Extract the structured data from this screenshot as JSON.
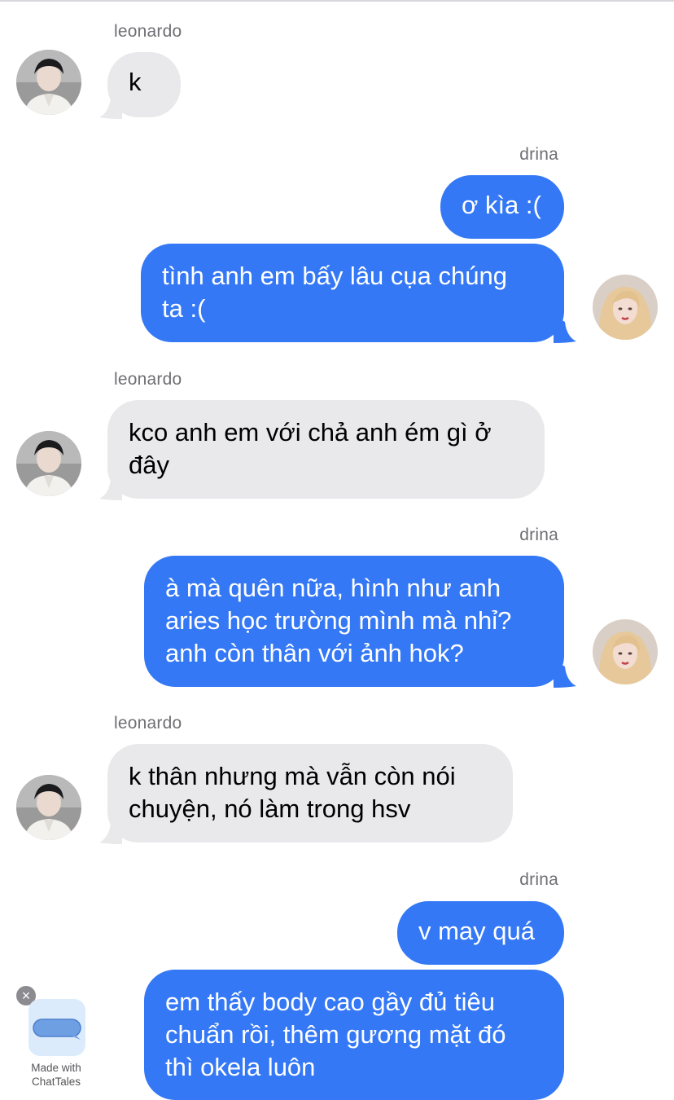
{
  "messages": [
    {
      "sender": "leonardo",
      "text": "k"
    },
    {
      "sender": "drina",
      "text": "ơ kìa :("
    },
    {
      "sender": "drina",
      "text": "tình anh em bấy lâu cụa chúng\nta :("
    },
    {
      "sender": "leonardo",
      "text": "kco anh em với chả anh ém gì ở\nđây"
    },
    {
      "sender": "drina",
      "text": "à mà quên nữa, hình như anh\naries học trường mình mà nhỉ?\nanh còn thân với ảnh hok?"
    },
    {
      "sender": "leonardo",
      "text": "k thân nhưng mà vẫn còn nói\nchuyện, nó làm trong hsv"
    },
    {
      "sender": "drina",
      "text": "v may quá"
    },
    {
      "sender": "drina",
      "text": "em thấy body cao gầy đủ tiêu\nchuẩn rồi, thêm gương mặt đó\nthì okela luôn"
    }
  ],
  "badge": {
    "close_glyph": "×",
    "label_line1": "Made with",
    "label_line2": "ChatTales"
  },
  "colors": {
    "incoming_bubble": "#e9e9eb",
    "outgoing_bubble": "#3478f6",
    "sender_name": "#6f6f74"
  },
  "icons": {
    "close": "close-icon",
    "app": "chat-bubble-icon"
  }
}
